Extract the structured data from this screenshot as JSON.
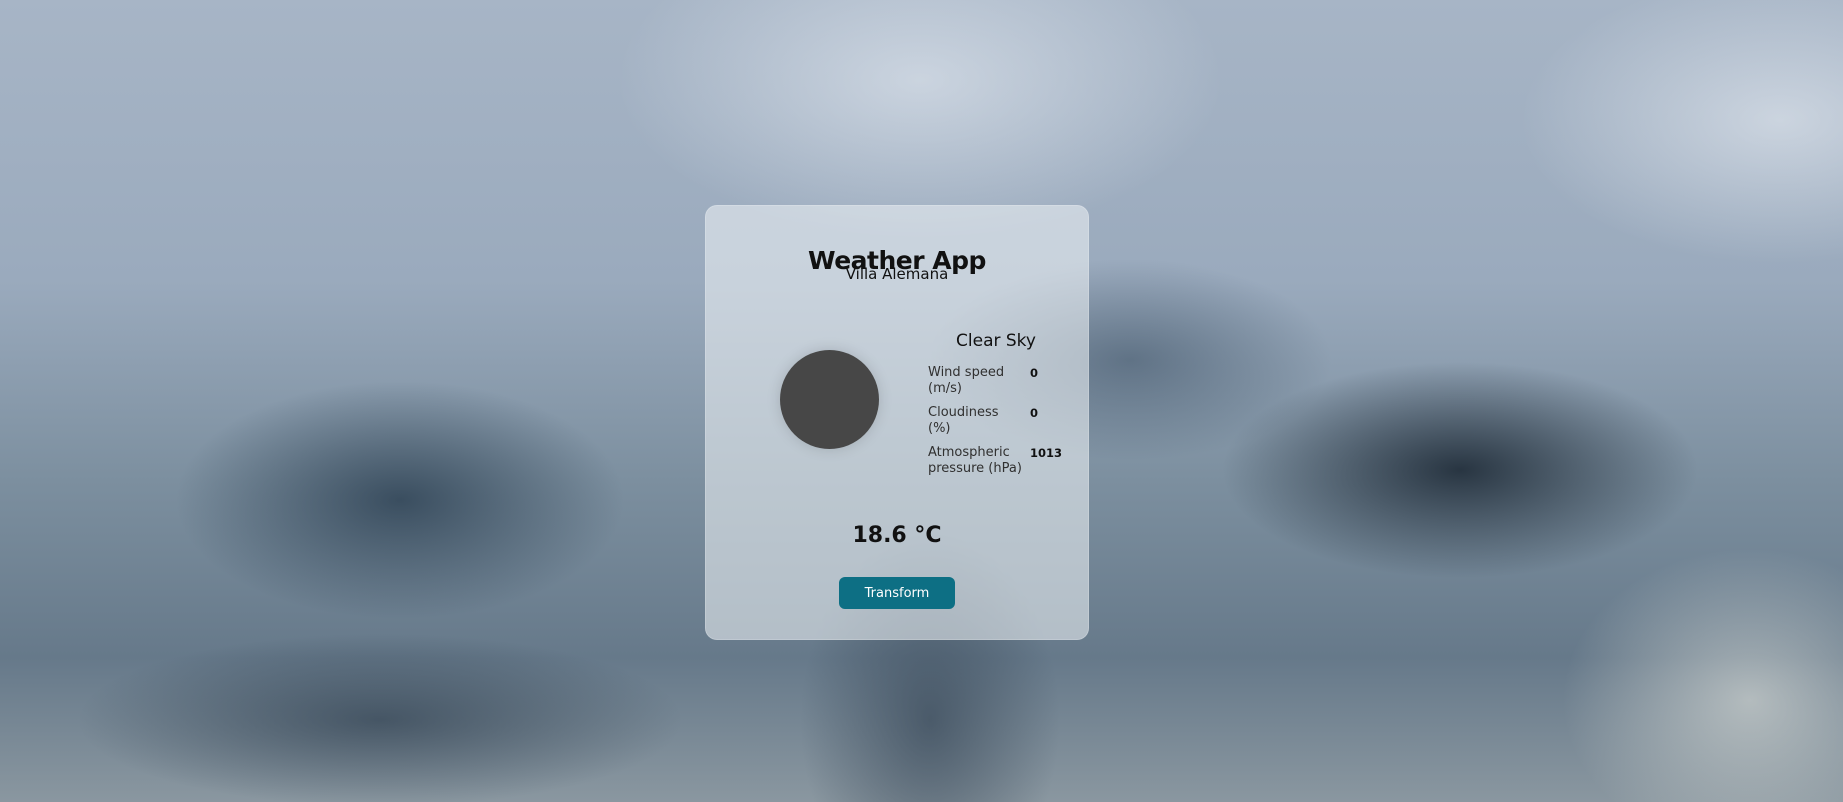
{
  "app": {
    "title": "Weather App",
    "city": "Villa Alemana"
  },
  "weather": {
    "description": "Clear Sky",
    "temperature": "18.6 °C",
    "stats": [
      {
        "label": "Wind speed (m/s)",
        "value": "0"
      },
      {
        "label": "Cloudiness (%)",
        "value": "0"
      },
      {
        "label": "Atmospheric pressure (hPa)",
        "value": "1013"
      }
    ]
  },
  "actions": {
    "transform_label": "Transform"
  },
  "icons": {
    "weather_icon": "weather-circle-icon"
  },
  "colors": {
    "button_background": "#0d6f84",
    "weather_icon_fill": "#474747"
  }
}
